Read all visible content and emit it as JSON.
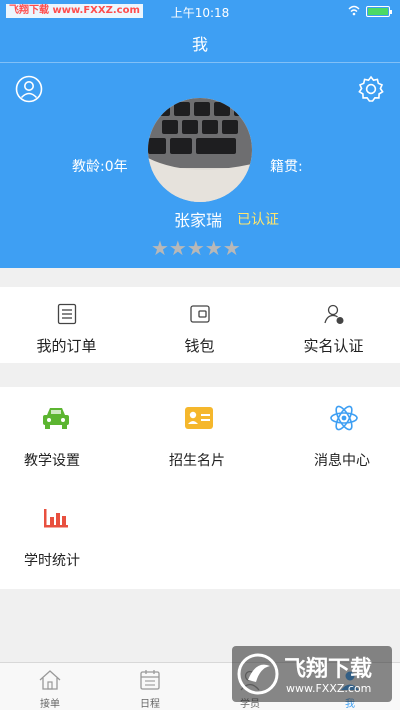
{
  "status_bar": {
    "brand": "飞翔下载 www.FXXZ.com",
    "time": "上午10:18"
  },
  "nav": {
    "title": "我"
  },
  "profile": {
    "teaching_age": "教龄:0年",
    "native_place": "籍贯:",
    "name": "张家瑞",
    "verified": "已认证",
    "rating_stars": 0,
    "max_stars": 5,
    "stars_text": "★★★★★"
  },
  "quick_menu": [
    {
      "label": "我的订单",
      "icon": "order-list-icon"
    },
    {
      "label": "钱包",
      "icon": "wallet-icon"
    },
    {
      "label": "实名认证",
      "icon": "identity-verify-icon"
    }
  ],
  "grid_menu": [
    {
      "label": "教学设置",
      "icon": "car-icon",
      "color": "#5cb531"
    },
    {
      "label": "招生名片",
      "icon": "business-card-icon",
      "color": "#f5b72c"
    },
    {
      "label": "消息中心",
      "icon": "atom-icon",
      "color": "#3e9ff3"
    },
    {
      "label": "学时统计",
      "icon": "bar-chart-icon",
      "color": "#e8503f"
    }
  ],
  "tabs": [
    {
      "label": "接单",
      "icon": "home-icon",
      "active": false
    },
    {
      "label": "日程",
      "icon": "calendar-icon",
      "active": false
    },
    {
      "label": "学员",
      "icon": "students-icon",
      "active": false
    },
    {
      "label": "我",
      "icon": "me-icon",
      "active": true
    }
  ],
  "watermark": {
    "title": "飞翔下载",
    "url": "www.FXXZ.com"
  },
  "colors": {
    "primary": "#3e9ff3",
    "verified": "#ffe66d",
    "background": "#f0f0f0"
  }
}
